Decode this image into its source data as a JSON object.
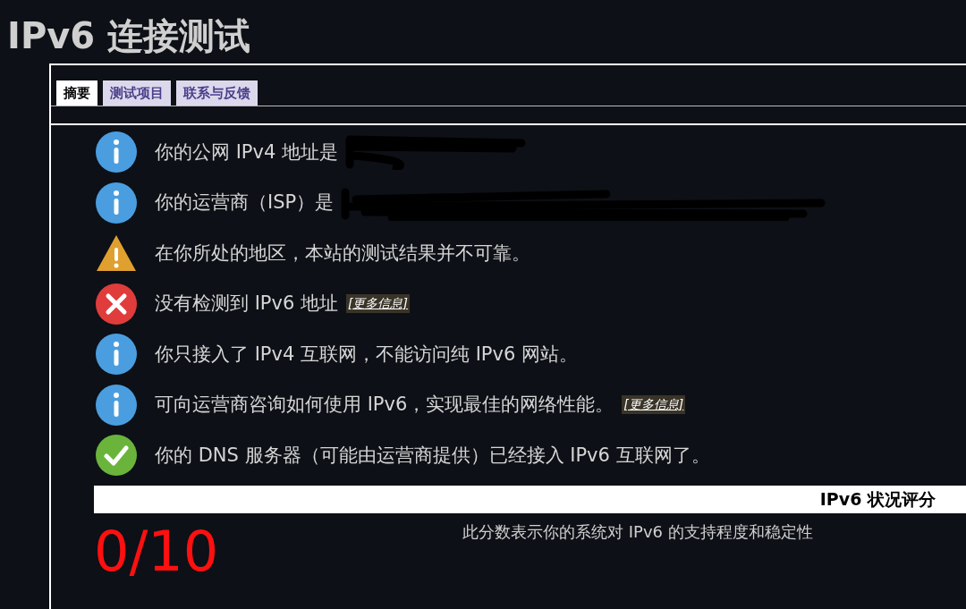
{
  "title": "IPv6 连接测试",
  "tabs": [
    {
      "label": "摘要",
      "selected": true
    },
    {
      "label": "测试项目",
      "selected": false
    },
    {
      "label": "联系与反馈",
      "selected": false
    }
  ],
  "results": [
    {
      "kind": "info",
      "text": "你的公网 IPv4 地址是",
      "redacted": true
    },
    {
      "kind": "info",
      "text": "你的运营商（ISP）是",
      "redacted": true
    },
    {
      "kind": "warning",
      "text": "在你所处的地区，本站的测试结果并不可靠。",
      "redacted": false
    },
    {
      "kind": "error",
      "text": "没有检测到 IPv6 地址",
      "link": "[更多信息]",
      "redacted": false
    },
    {
      "kind": "info",
      "text": "你只接入了 IPv4 互联网，不能访问纯 IPv6 网站。",
      "redacted": false
    },
    {
      "kind": "info",
      "text": "可向运营商咨询如何使用 IPv6，实现最佳的网络性能。",
      "link": "[更多信息]",
      "redacted": false
    },
    {
      "kind": "ok",
      "text": "你的 DNS 服务器（可能由运营商提供）已经接入 IPv6 互联网了。",
      "redacted": false
    }
  ],
  "score": {
    "heading": "IPv6 状况评分",
    "value": "0/10",
    "description": "此分数表示你的系统对 IPv6 的支持程度和稳定性"
  }
}
